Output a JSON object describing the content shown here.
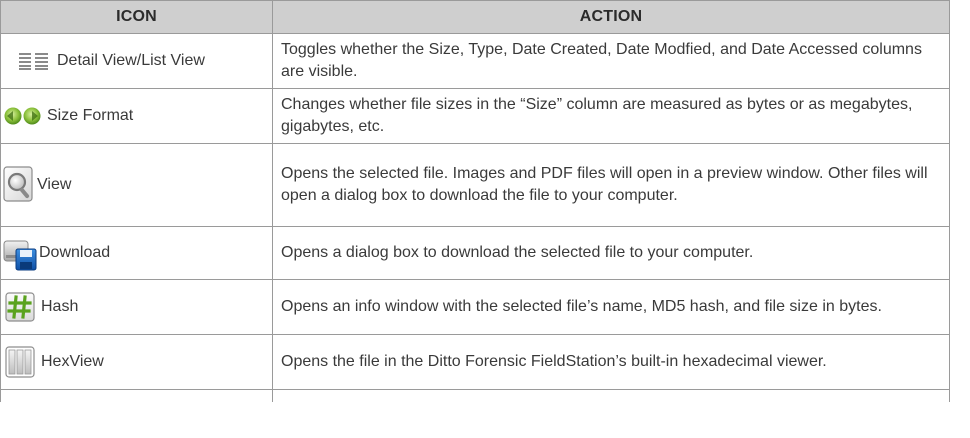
{
  "header": {
    "icon_col": "ICON",
    "action_col": "ACTION"
  },
  "rows": [
    {
      "icon": "detail-list-icon",
      "label": "Detail View/List View",
      "action": "Toggles whether the Size, Type, Date Created, Date Modfied, and Date Accessed columns are visible."
    },
    {
      "icon": "size-format-icon",
      "label": "Size Format",
      "action": "Changes whether file sizes in the “Size” column are measured as bytes or as megabytes, gigabytes, etc."
    },
    {
      "icon": "view-magnifier-icon",
      "label": "View",
      "action": "Opens the selected file. Images and PDF files will open in a preview window. Other files will open a dialog box to download the file to your computer."
    },
    {
      "icon": "download-disk-icon",
      "label": "Download",
      "action": "Opens a dialog box to download the selected file to your computer."
    },
    {
      "icon": "hash-icon",
      "label": "Hash",
      "action": "Opens an info window with the selected file’s name, MD5 hash, and file size in bytes."
    },
    {
      "icon": "hexview-icon",
      "label": "HexView",
      "action": "Opens the file in the Ditto Forensic FieldStation’s built-in hexadecimal viewer."
    }
  ]
}
